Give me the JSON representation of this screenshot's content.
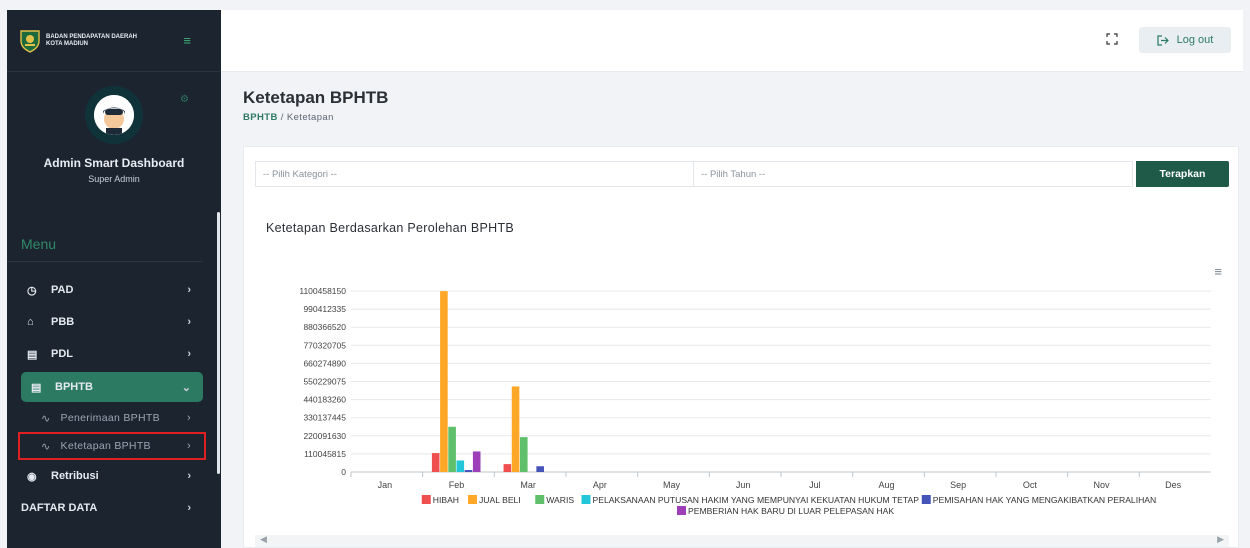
{
  "brand": {
    "line1": "BADAN PENDAPATAN DAERAH",
    "line2": "KOTA MADIUN"
  },
  "profile": {
    "name": "Admin Smart Dashboard",
    "role": "Super Admin"
  },
  "menu": {
    "title": "Menu",
    "items": [
      {
        "label": "PAD",
        "icon": "clock-icon"
      },
      {
        "label": "PBB",
        "icon": "home-icon"
      },
      {
        "label": "PDL",
        "icon": "box-icon"
      },
      {
        "label": "BPHTB",
        "icon": "file-icon"
      }
    ],
    "sub_items": [
      {
        "label": "Penerimaan BPHTB",
        "icon": "pulse-icon"
      },
      {
        "label": "Ketetapan BPHTB",
        "icon": "pulse-icon"
      }
    ],
    "after_items": [
      {
        "label": "Retribusi",
        "icon": "eye-icon"
      },
      {
        "label": "DAFTAR DATA",
        "icon": ""
      }
    ]
  },
  "topbar": {
    "logout_label": "Log out"
  },
  "page": {
    "title": "Ketetapan BPHTB",
    "breadcrumb_root": "BPHTB",
    "breadcrumb_sep": "/",
    "breadcrumb_current": "Ketetapan"
  },
  "filters": {
    "category_placeholder": "-- Pilih Kategori --",
    "year_placeholder": "-- Pilih Tahun --",
    "apply_label": "Terapkan"
  },
  "colors": {
    "accent": "#2d7a63",
    "sidebar_bg": "#1c2430",
    "highlight_box": "#e02020"
  },
  "chart_data": {
    "type": "bar",
    "title": "Ketetapan Berdasarkan Perolehan BPHTB",
    "xlabel": "",
    "ylabel": "",
    "ylim": [
      0,
      1100458150
    ],
    "yticks": [
      0,
      110045815,
      220091630,
      330137445,
      440183260,
      550229075,
      660274890,
      770320705,
      880366520,
      990412335,
      1100458150
    ],
    "categories": [
      "Jan",
      "Feb",
      "Mar",
      "Apr",
      "May",
      "Jun",
      "Jul",
      "Aug",
      "Sep",
      "Oct",
      "Nov",
      "Des"
    ],
    "grid": true,
    "legend_position": "bottom",
    "series": [
      {
        "name": "HIBAH",
        "color": "#ef4f4f",
        "values": [
          0,
          115000000,
          48000000,
          0,
          0,
          0,
          0,
          0,
          0,
          0,
          0,
          0
        ]
      },
      {
        "name": "JUAL BELI",
        "color": "#ffa726",
        "values": [
          0,
          1100000000,
          520000000,
          0,
          0,
          0,
          0,
          0,
          0,
          0,
          0,
          0
        ]
      },
      {
        "name": "WARIS",
        "color": "#5fbf6a",
        "values": [
          0,
          275000000,
          212000000,
          0,
          0,
          0,
          0,
          0,
          0,
          0,
          0,
          0
        ]
      },
      {
        "name": "PELAKSANAAN PUTUSAN HAKIM YANG MEMPUNYAI KEKUATAN HUKUM TETAP",
        "color": "#23c6d9",
        "values": [
          0,
          70000000,
          0,
          0,
          0,
          0,
          0,
          0,
          0,
          0,
          0,
          0
        ]
      },
      {
        "name": "PEMISAHAN HAK YANG MENGAKIBATKAN PERALIHAN",
        "color": "#4653b8",
        "values": [
          0,
          12000000,
          35000000,
          0,
          0,
          0,
          0,
          0,
          0,
          0,
          0,
          0
        ]
      },
      {
        "name": "PEMBERIAN HAK BARU DI LUAR PELEPASAN HAK",
        "color": "#9c3fb8",
        "values": [
          0,
          125000000,
          0,
          0,
          0,
          0,
          0,
          0,
          0,
          0,
          0,
          0
        ]
      }
    ]
  }
}
